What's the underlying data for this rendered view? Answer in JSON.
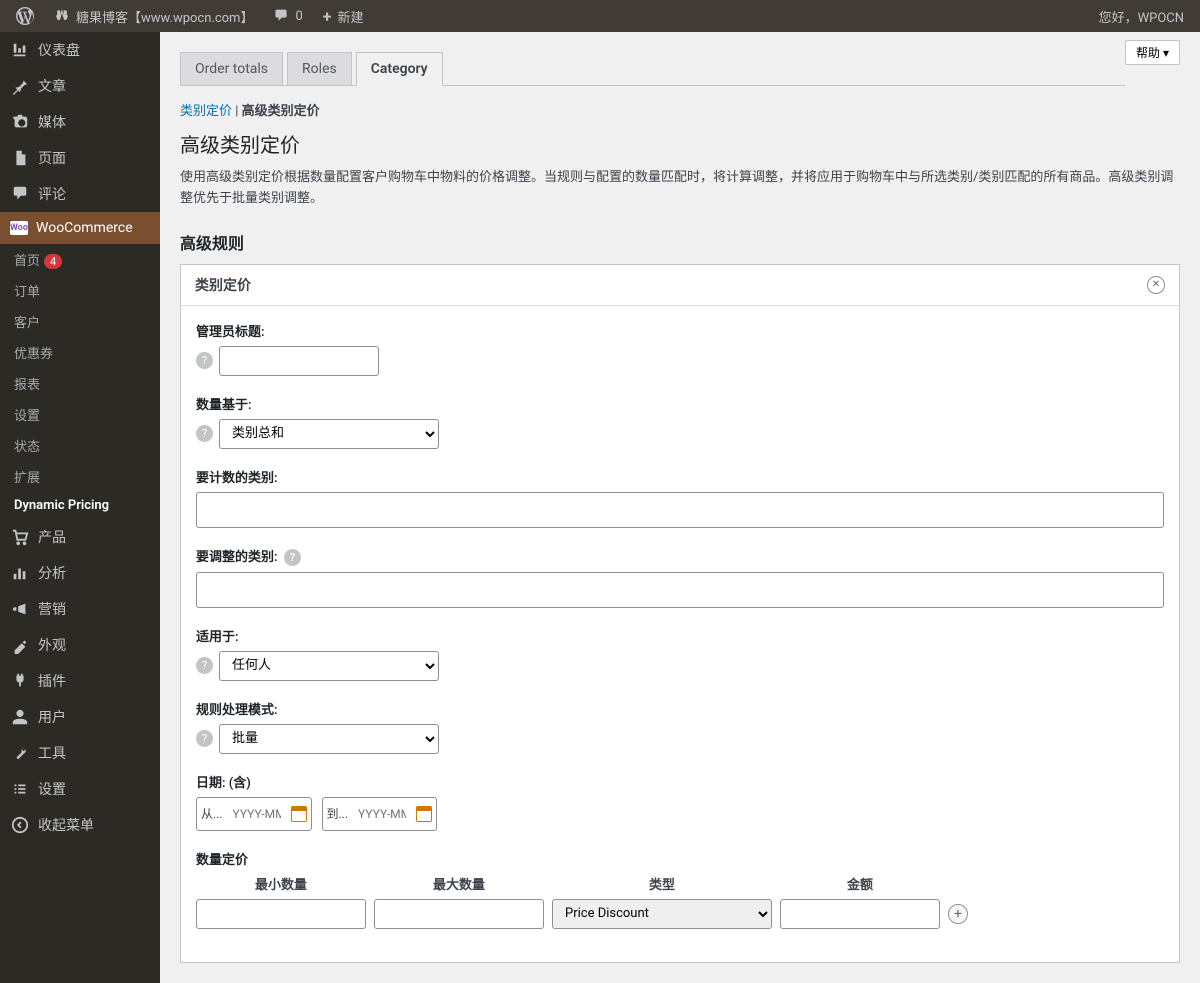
{
  "toolbar": {
    "site_name": "糖果博客【www.wpocn.com】",
    "comments": "0",
    "new_label": "新建",
    "greeting": "您好，WPOCN"
  },
  "help_btn": "帮助 ▾",
  "sidebar": {
    "dashboard": "仪表盘",
    "posts": "文章",
    "media": "媒体",
    "pages": "页面",
    "comments": "评论",
    "woocommerce": "WooCommerce",
    "woo_sub": {
      "home": "首页",
      "home_badge": "4",
      "orders": "订单",
      "customers": "客户",
      "coupons": "优惠券",
      "reports": "报表",
      "settings": "设置",
      "status": "状态",
      "extensions": "扩展",
      "dynamic_pricing": "Dynamic Pricing"
    },
    "products": "产品",
    "analytics": "分析",
    "marketing": "营销",
    "appearance": "外观",
    "plugins": "插件",
    "users": "用户",
    "tools": "工具",
    "settings_main": "设置",
    "collapse": "收起菜单"
  },
  "tabs": {
    "order_totals": "Order totals",
    "roles": "Roles",
    "category": "Category"
  },
  "breadcrumb": {
    "link": "类别定价",
    "sep": " | ",
    "current": "高级类别定价"
  },
  "page": {
    "title": "高级类别定价",
    "desc": "使用高级类别定价根据数量配置客户购物车中物料的价格调整。当规则与配置的数量匹配时，将计算调整，并将应用于购物车中与所选类别/类别匹配的所有商品。高级类别调整优先于批量类别调整。",
    "section_title": "高级规则"
  },
  "panel": {
    "title": "类别定价",
    "admin_title_label": "管理员标题:",
    "qty_based_label": "数量基于:",
    "qty_based_value": "类别总和",
    "count_cat_label": "要计数的类别:",
    "adjust_cat_label": "要调整的类别:",
    "applies_to_label": "适用于:",
    "applies_to_value": "任何人",
    "rule_mode_label": "规则处理模式:",
    "rule_mode_value": "批量",
    "date_label": "日期: (含)",
    "date_from_prefix": "从...",
    "date_to_prefix": "到...",
    "date_placeholder": "YYYY-MM",
    "qty_pricing_label": "数量定价",
    "col_min": "最小数量",
    "col_max": "最大数量",
    "col_type": "类型",
    "col_amount": "金额",
    "type_value": "Price Discount"
  }
}
